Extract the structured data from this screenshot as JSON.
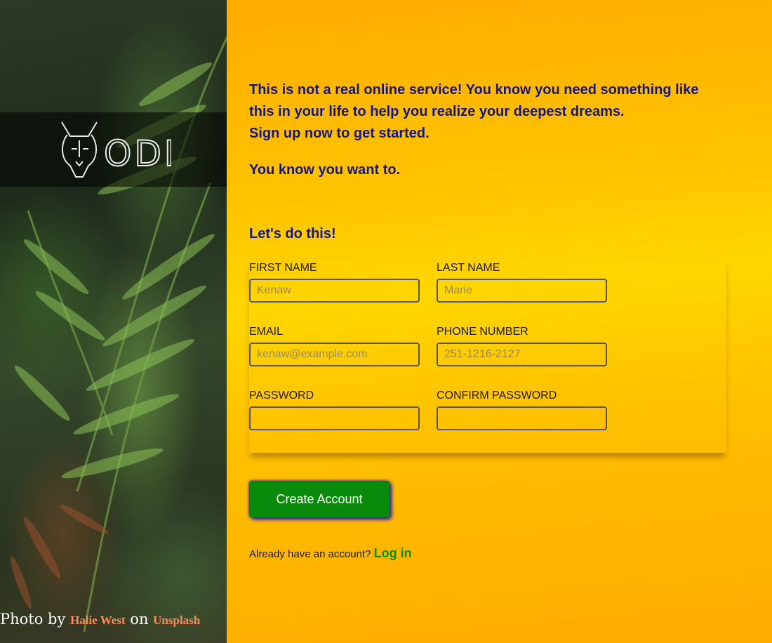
{
  "brand": {
    "logo_text": "ODIN",
    "logo_icon": "viking-dog-icon"
  },
  "photo_credit": {
    "prefix": "Photo by",
    "author": "Halie West",
    "middle": "on",
    "source": "Unsplash"
  },
  "intro": {
    "line1": "This is not a real online service! You know you need something like this in your life to help you realize your deepest dreams.",
    "line2": "Sign up now to get started.",
    "line3": "You know you want to."
  },
  "form": {
    "title": "Let's do this!",
    "fields": {
      "first_name": {
        "label": "FIRST NAME",
        "placeholder": "Kenaw",
        "value": ""
      },
      "last_name": {
        "label": "LAST NAME",
        "placeholder": "Marie",
        "value": ""
      },
      "email": {
        "label": "EMAIL",
        "placeholder": "kenaw@example.com",
        "value": ""
      },
      "phone": {
        "label": "PHONE NUMBER",
        "placeholder": "251-1216-2127",
        "value": ""
      },
      "password": {
        "label": "PASSWORD",
        "placeholder": "",
        "value": ""
      },
      "confirm_password": {
        "label": "CONFIRM PASSWORD",
        "placeholder": "",
        "value": ""
      }
    },
    "submit_label": "Create Account"
  },
  "login": {
    "prompt": "Already have an account?",
    "link_label": "Log in"
  },
  "colors": {
    "heading": "#15167a",
    "button": "#0a8a0a",
    "button_glow": "#2a14c8",
    "link": "#0a8a0a",
    "background_start": "#ffab00",
    "background_mid": "#ffd600"
  }
}
